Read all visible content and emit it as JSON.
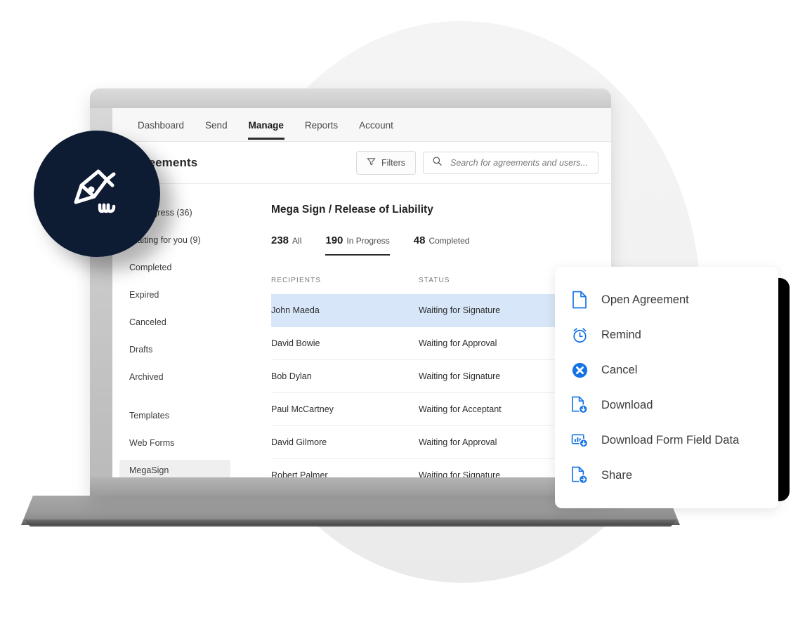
{
  "nav": {
    "items": [
      {
        "label": "Dashboard",
        "active": false
      },
      {
        "label": "Send",
        "active": false
      },
      {
        "label": "Manage",
        "active": true
      },
      {
        "label": "Reports",
        "active": false
      },
      {
        "label": "Account",
        "active": false
      }
    ]
  },
  "subbar": {
    "page_title": "Agreements",
    "filters_label": "Filters",
    "search_placeholder": "Search for agreements and users...",
    "search_value": ""
  },
  "sidebar": {
    "items": [
      {
        "label": "In Progress (36)",
        "selected": false,
        "gap_after": false
      },
      {
        "label": "Waiting for you (9)",
        "selected": false,
        "gap_after": false
      },
      {
        "label": "Completed",
        "selected": false,
        "gap_after": false
      },
      {
        "label": "Expired",
        "selected": false,
        "gap_after": false
      },
      {
        "label": "Canceled",
        "selected": false,
        "gap_after": false
      },
      {
        "label": "Drafts",
        "selected": false,
        "gap_after": false
      },
      {
        "label": "Archived",
        "selected": false,
        "gap_after": true
      },
      {
        "label": "Templates",
        "selected": false,
        "gap_after": false
      },
      {
        "label": "Web Forms",
        "selected": false,
        "gap_after": false
      },
      {
        "label": "MegaSign",
        "selected": true,
        "gap_after": false
      }
    ]
  },
  "main": {
    "title": "Mega Sign / Release of Liability",
    "stat_tabs": [
      {
        "count": "238",
        "label": "All",
        "active": false
      },
      {
        "count": "190",
        "label": "In Progress",
        "active": true
      },
      {
        "count": "48",
        "label": "Completed",
        "active": false
      }
    ],
    "table": {
      "headers": {
        "recipients": "RECIPIENTS",
        "status": "STATUS"
      },
      "rows": [
        {
          "recipient": "John Maeda",
          "status": "Waiting for Signature",
          "highlight": true
        },
        {
          "recipient": "David Bowie",
          "status": "Waiting for Approval",
          "highlight": false
        },
        {
          "recipient": "Bob Dylan",
          "status": "Waiting for Signature",
          "highlight": false
        },
        {
          "recipient": "Paul McCartney",
          "status": "Waiting for Acceptant",
          "highlight": false
        },
        {
          "recipient": "David Gilmore",
          "status": "Waiting for Approval",
          "highlight": false
        },
        {
          "recipient": "Robert Palmer",
          "status": "Waiting for Signature",
          "highlight": false
        }
      ]
    }
  },
  "context_menu": {
    "items": [
      {
        "label": "Open Agreement",
        "icon": "document-icon"
      },
      {
        "label": "Remind",
        "icon": "alarm-clock-icon"
      },
      {
        "label": "Cancel",
        "icon": "cancel-circle-icon"
      },
      {
        "label": "Download",
        "icon": "document-download-icon"
      },
      {
        "label": "Download Form Field Data",
        "icon": "chart-download-icon"
      },
      {
        "label": "Share",
        "icon": "document-share-icon"
      }
    ]
  },
  "logo": {
    "name": "pen-nib-signature-icon"
  },
  "colors": {
    "accent_blue": "#1473E6",
    "badge_navy": "#0D1B33",
    "row_highlight": "#D7E6F8",
    "nav_underline": "#2C2C2C"
  }
}
